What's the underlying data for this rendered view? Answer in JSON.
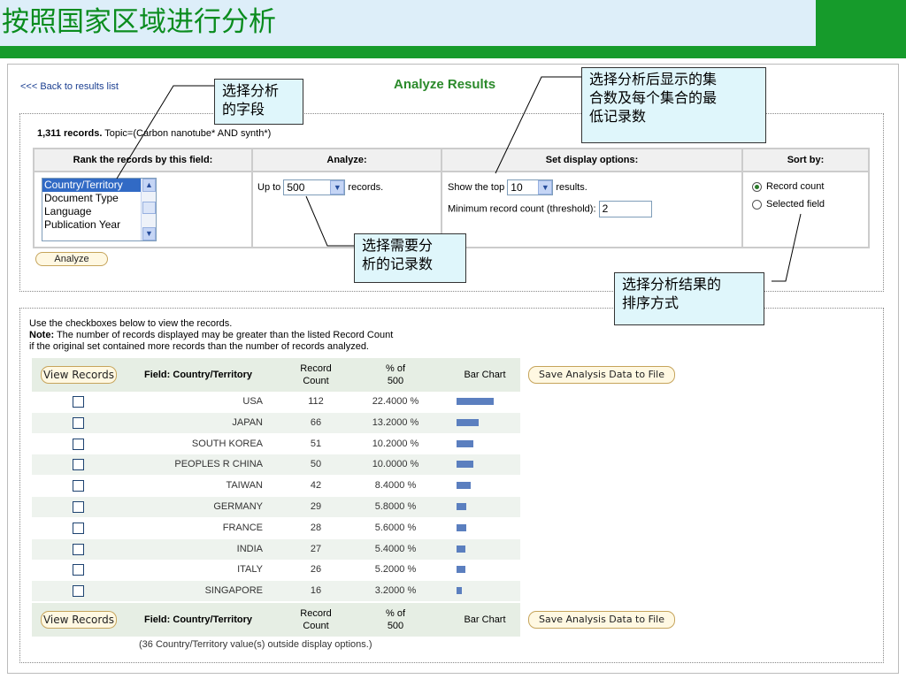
{
  "slide": {
    "title": "按照国家区域进行分析"
  },
  "page": {
    "back_link": "<<< Back to results list",
    "heading": "Analyze Results",
    "records_count": "1,311 records.",
    "topic": "Topic=(Carbon nanotube* AND synth*)"
  },
  "options": {
    "col_rank": "Rank the records by this field:",
    "col_analyze": "Analyze:",
    "col_display": "Set display options:",
    "col_sort": "Sort by:",
    "fields": [
      "Country/Territory",
      "Document Type",
      "Language",
      "Publication Year"
    ],
    "selected_field": "Country/Territory",
    "analyze_prefix": "Up to",
    "analyze_value": "500",
    "analyze_suffix": "records.",
    "show_top_prefix": "Show the top",
    "show_top_value": "10",
    "show_top_suffix": "results.",
    "threshold_label": "Minimum record count (threshold):",
    "threshold_value": "2",
    "sort_record_count": "Record count",
    "sort_selected_field": "Selected field",
    "sort_selected": "Record count",
    "analyze_button": "Analyze"
  },
  "results": {
    "intro_line1": "Use the checkboxes below to view the records.",
    "note_label": "Note:",
    "intro_line2": " The number of records displayed may be greater than the listed Record Count",
    "intro_line3": "if the original set contained more records than the number of records analyzed.",
    "view_records_button": "View Records",
    "field_header": "Field: Country/Territory",
    "count_header": "Record\nCount",
    "pct_header": "% of\n500",
    "bar_header": "Bar Chart",
    "save_button": "Save Analysis Data to File",
    "rows": [
      {
        "country": "USA",
        "count": 112,
        "pct": "22.4000 %",
        "share": 22.4
      },
      {
        "country": "JAPAN",
        "count": 66,
        "pct": "13.2000 %",
        "share": 13.2
      },
      {
        "country": "SOUTH KOREA",
        "count": 51,
        "pct": "10.2000 %",
        "share": 10.2
      },
      {
        "country": "PEOPLES R CHINA",
        "count": 50,
        "pct": "10.0000 %",
        "share": 10.0
      },
      {
        "country": "TAIWAN",
        "count": 42,
        "pct": "8.4000 %",
        "share": 8.4
      },
      {
        "country": "GERMANY",
        "count": 29,
        "pct": "5.8000 %",
        "share": 5.8
      },
      {
        "country": "FRANCE",
        "count": 28,
        "pct": "5.6000 %",
        "share": 5.6
      },
      {
        "country": "INDIA",
        "count": 27,
        "pct": "5.4000 %",
        "share": 5.4
      },
      {
        "country": "ITALY",
        "count": 26,
        "pct": "5.2000 %",
        "share": 5.2
      },
      {
        "country": "SINGAPORE",
        "count": 16,
        "pct": "3.2000 %",
        "share": 3.2
      }
    ],
    "footer_note": "(36 Country/Territory value(s) outside display options.)"
  },
  "callouts": {
    "field": "选择分析\n的字段",
    "records": "选择需要分\n析的记录数",
    "display": "选择分析后显示的集\n合数及每个集合的最\n低记录数",
    "sort": "选择分析结果的\n排序方式"
  },
  "colors": {
    "title_green": "#0a8c1e",
    "band_green": "#169b2b",
    "bar_blue": "#5b7fbf",
    "callout_bg": "#dff6fb"
  }
}
